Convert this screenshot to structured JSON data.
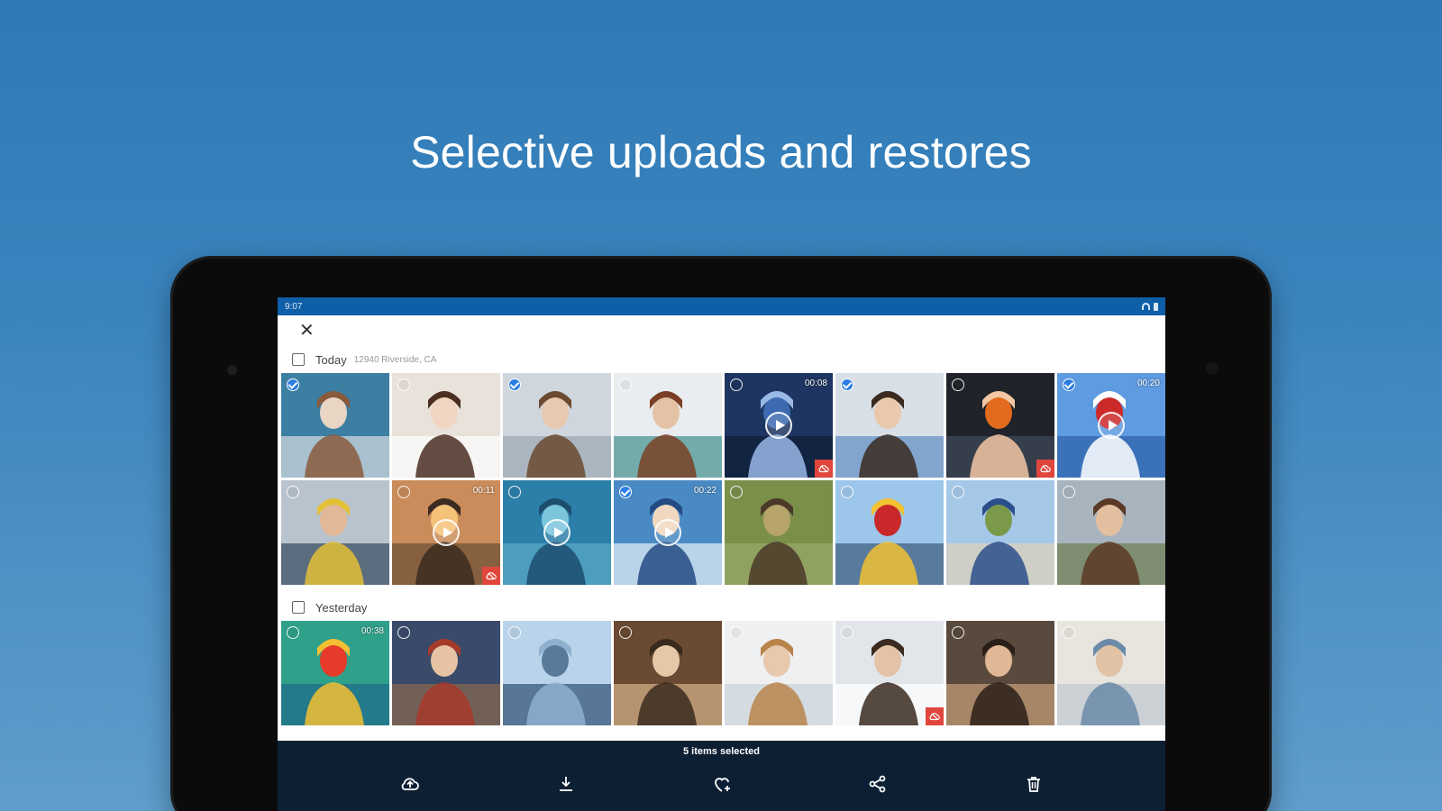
{
  "headline": "Selective uploads and restores",
  "status": {
    "time": "9:07"
  },
  "sections": [
    {
      "title": "Today",
      "location": "12940 Riverside, CA",
      "items": [
        {
          "checked": true,
          "duration": "",
          "video": false,
          "cloud": false,
          "scene": "woman-laptop"
        },
        {
          "checked": false,
          "duration": "",
          "video": false,
          "cloud": false,
          "scene": "woman-phone"
        },
        {
          "checked": true,
          "duration": "",
          "video": false,
          "cloud": false,
          "scene": "woman-office"
        },
        {
          "checked": false,
          "duration": "",
          "video": false,
          "cloud": false,
          "scene": "woman-glasses"
        },
        {
          "checked": false,
          "duration": "00:08",
          "video": true,
          "cloud": true,
          "scene": "server-room"
        },
        {
          "checked": true,
          "duration": "",
          "video": false,
          "cloud": false,
          "scene": "family"
        },
        {
          "checked": false,
          "duration": "",
          "video": false,
          "cloud": true,
          "scene": "hardhats"
        },
        {
          "checked": true,
          "duration": "00:20",
          "video": true,
          "cloud": false,
          "scene": "skydivers"
        },
        {
          "checked": false,
          "duration": "",
          "video": false,
          "cloud": false,
          "scene": "team-laptop"
        },
        {
          "checked": false,
          "duration": "00:11",
          "video": true,
          "cloud": true,
          "scene": "savanna-tree"
        },
        {
          "checked": false,
          "duration": "",
          "video": true,
          "cloud": false,
          "scene": "manta-ray"
        },
        {
          "checked": true,
          "duration": "00:22",
          "video": true,
          "cloud": false,
          "scene": "jetski"
        },
        {
          "checked": false,
          "duration": "",
          "video": false,
          "cloud": false,
          "scene": "deer-field"
        },
        {
          "checked": false,
          "duration": "",
          "video": false,
          "cloud": false,
          "scene": "balloons"
        },
        {
          "checked": false,
          "duration": "",
          "video": false,
          "cloud": false,
          "scene": "cyclists"
        },
        {
          "checked": false,
          "duration": "",
          "video": false,
          "cloud": false,
          "scene": "smiling-woman"
        }
      ]
    },
    {
      "title": "Yesterday",
      "location": "",
      "items": [
        {
          "checked": false,
          "duration": "00:38",
          "video": false,
          "cloud": false,
          "scene": "rafting"
        },
        {
          "checked": false,
          "duration": "",
          "video": false,
          "cloud": false,
          "scene": "man-glasses"
        },
        {
          "checked": false,
          "duration": "",
          "video": false,
          "cloud": false,
          "scene": "building"
        },
        {
          "checked": false,
          "duration": "",
          "video": false,
          "cloud": false,
          "scene": "cafe"
        },
        {
          "checked": false,
          "duration": "",
          "video": false,
          "cloud": false,
          "scene": "woman-thinking"
        },
        {
          "checked": false,
          "duration": "",
          "video": false,
          "cloud": true,
          "scene": "woman-desk"
        },
        {
          "checked": false,
          "duration": "",
          "video": false,
          "cloud": false,
          "scene": "friends"
        },
        {
          "checked": false,
          "duration": "",
          "video": false,
          "cloud": false,
          "scene": "meeting"
        }
      ]
    }
  ],
  "selection_label": "5 items selected",
  "actions": [
    {
      "name": "upload-button",
      "icon": "cloud-upload-icon"
    },
    {
      "name": "download-button",
      "icon": "download-icon"
    },
    {
      "name": "favorite-button",
      "icon": "heart-plus-icon"
    },
    {
      "name": "share-button",
      "icon": "share-icon"
    },
    {
      "name": "delete-button",
      "icon": "trash-icon"
    }
  ],
  "colors": {
    "accent": "#0e5ea8",
    "bar": "#0d1f33",
    "cloud_badge": "#e0463c",
    "check": "#2a7de1"
  }
}
